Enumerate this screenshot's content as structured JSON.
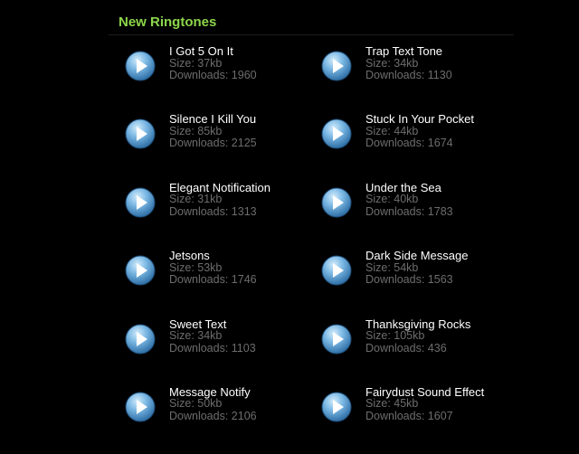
{
  "section": {
    "title": "New Ringtones"
  },
  "labels": {
    "size_prefix": "Size: ",
    "downloads_prefix": "Downloads: "
  },
  "colors": {
    "title": "#8cd64a",
    "name": "#ffffff",
    "meta": "#6d6d6d",
    "background": "#000000",
    "play_button": "#5a9fd4"
  },
  "icons": {
    "play": "play-button-icon"
  },
  "ringtones": [
    {
      "name": "I Got 5 On It",
      "size": "37kb",
      "downloads": "1960"
    },
    {
      "name": "Trap Text Tone",
      "size": "34kb",
      "downloads": "1130"
    },
    {
      "name": "Silence I Kill You",
      "size": "85kb",
      "downloads": "2125"
    },
    {
      "name": "Stuck In Your Pocket",
      "size": "44kb",
      "downloads": "1674"
    },
    {
      "name": "Elegant Notification",
      "size": "31kb",
      "downloads": "1313"
    },
    {
      "name": "Under the Sea",
      "size": "40kb",
      "downloads": "1783"
    },
    {
      "name": "Jetsons",
      "size": "53kb",
      "downloads": "1746"
    },
    {
      "name": "Dark Side Message",
      "size": "54kb",
      "downloads": "1563"
    },
    {
      "name": "Sweet Text",
      "size": "34kb",
      "downloads": "1103"
    },
    {
      "name": "Thanksgiving Rocks",
      "size": "105kb",
      "downloads": "436"
    },
    {
      "name": "Message Notify",
      "size": "50kb",
      "downloads": "2106"
    },
    {
      "name": "Fairydust Sound Effect",
      "size": "45kb",
      "downloads": "1607"
    }
  ]
}
